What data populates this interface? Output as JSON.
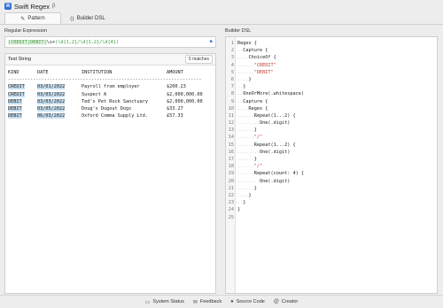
{
  "window": {
    "title": "Swift Regex",
    "icon": "swift-regex-app-icon",
    "title_badge": "β"
  },
  "tabs": [
    {
      "label": "Pattern",
      "icon": "magic-wand-icon",
      "active": true
    },
    {
      "label": "Builder DSL",
      "icon": "code-brackets-icon",
      "active": false
    }
  ],
  "regex": {
    "label": "Regular Expression",
    "value": "(CREDIT|DEBIT)\\s+(\\d{1,2}/\\d{1,2}/\\d{4})",
    "parts": [
      "(CREDIT|DEBIT)",
      "\\s+",
      "(\\d{1,2}/\\d{1,2}/\\d{4})"
    ],
    "flag_icon": "flag-icon"
  },
  "test": {
    "label": "Test String",
    "match_count": "5 matches",
    "headers": [
      "KIND",
      "DATE",
      "INSTITUTION",
      "AMOUNT"
    ],
    "separator": "----------------------------------------------------------------------",
    "rows": [
      [
        "CREDIT",
        "03/01/2022",
        "Payroll from employer",
        "$200.23"
      ],
      [
        "CREDIT",
        "03/03/2022",
        "Suspect A",
        "$2,000,000.00"
      ],
      [
        "DEBIT",
        "03/03/2022",
        "Ted's Pet Rock Sanctuary",
        "$2,000,000.00"
      ],
      [
        "DEBIT",
        "03/05/2022",
        "Doug's Dugout Dogs",
        "$33.27"
      ],
      [
        "DEBIT",
        "06/03/2022",
        "Oxford Comma Supply Ltd.",
        "£57.33"
      ]
    ]
  },
  "dsl": {
    "label": "Builder DSL",
    "lines": [
      {
        "n": "1",
        "indent": "",
        "code": "Regex {"
      },
      {
        "n": "2",
        "indent": "..",
        "code": "Capture {"
      },
      {
        "n": "3",
        "indent": "....",
        "code": "ChoiceOf {"
      },
      {
        "n": "4",
        "indent": "......",
        "code": "\"CREDIT\""
      },
      {
        "n": "5",
        "indent": "......",
        "code": "\"DEBIT\""
      },
      {
        "n": "6",
        "indent": "....",
        "code": "}"
      },
      {
        "n": "7",
        "indent": "..",
        "code": "}"
      },
      {
        "n": "8",
        "indent": "..",
        "code": "OneOrMore(.whitespace)"
      },
      {
        "n": "9",
        "indent": "..",
        "code": "Capture {"
      },
      {
        "n": "10",
        "indent": "....",
        "code": "Regex {"
      },
      {
        "n": "11",
        "indent": "......",
        "code": "Repeat(1...2) {"
      },
      {
        "n": "12",
        "indent": "........",
        "code": "One(.digit)"
      },
      {
        "n": "13",
        "indent": "......",
        "code": "}"
      },
      {
        "n": "14",
        "indent": "......",
        "code": "\"/\""
      },
      {
        "n": "15",
        "indent": "......",
        "code": "Repeat(1...2) {"
      },
      {
        "n": "16",
        "indent": "........",
        "code": "One(.digit)"
      },
      {
        "n": "17",
        "indent": "......",
        "code": "}"
      },
      {
        "n": "18",
        "indent": "......",
        "code": "\"/\""
      },
      {
        "n": "19",
        "indent": "......",
        "code": "Repeat(count: 4) {"
      },
      {
        "n": "20",
        "indent": "........",
        "code": "One(.digit)"
      },
      {
        "n": "21",
        "indent": "......",
        "code": "}"
      },
      {
        "n": "22",
        "indent": "....",
        "code": "}"
      },
      {
        "n": "23",
        "indent": "..",
        "code": "}"
      },
      {
        "n": "24",
        "indent": "",
        "code": "}"
      },
      {
        "n": "25",
        "indent": "",
        "code": ""
      }
    ]
  },
  "status": [
    {
      "label": "System Status",
      "icon": "status-monitor-icon"
    },
    {
      "label": "Feedback",
      "icon": "feedback-chat-icon"
    },
    {
      "label": "Source Code",
      "icon": "github-icon"
    },
    {
      "label": "Creator",
      "icon": "creator-at-icon"
    }
  ],
  "colors": {
    "accent": "#2f6fd6",
    "match_highlight": "#c6dff0",
    "string": "#c0392b",
    "regex_green": "#3a9a3a"
  }
}
